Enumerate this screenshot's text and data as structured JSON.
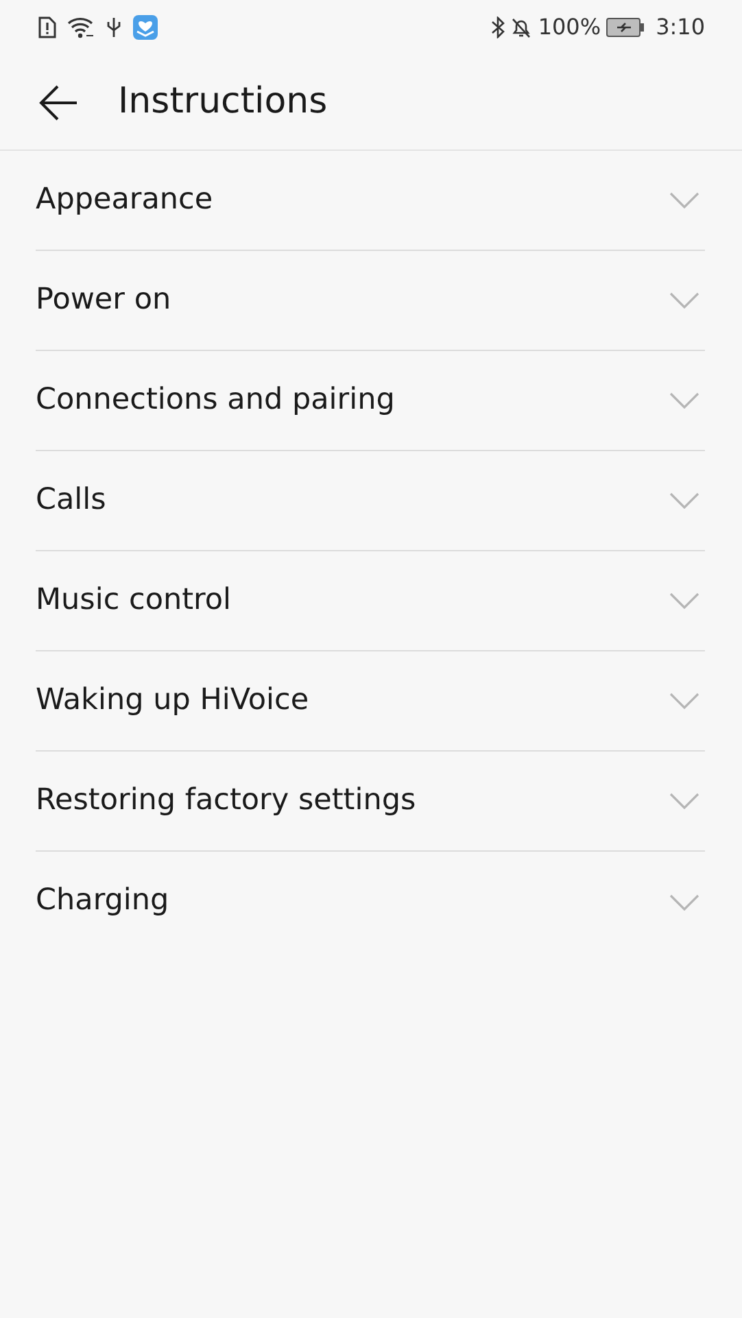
{
  "status_bar": {
    "battery_text": "100%",
    "time": "3:10"
  },
  "header": {
    "title": "Instructions"
  },
  "sections": [
    {
      "label": "Appearance",
      "expanded": false
    },
    {
      "label": "Power on",
      "expanded": false
    },
    {
      "label": "Connections and pairing",
      "expanded": false
    },
    {
      "label": "Calls",
      "expanded": false
    },
    {
      "label": "Music control",
      "expanded": false
    },
    {
      "label": "Waking up HiVoice",
      "expanded": false
    },
    {
      "label": "Restoring factory settings",
      "expanded": false
    },
    {
      "label": "Charging",
      "expanded": false
    }
  ]
}
